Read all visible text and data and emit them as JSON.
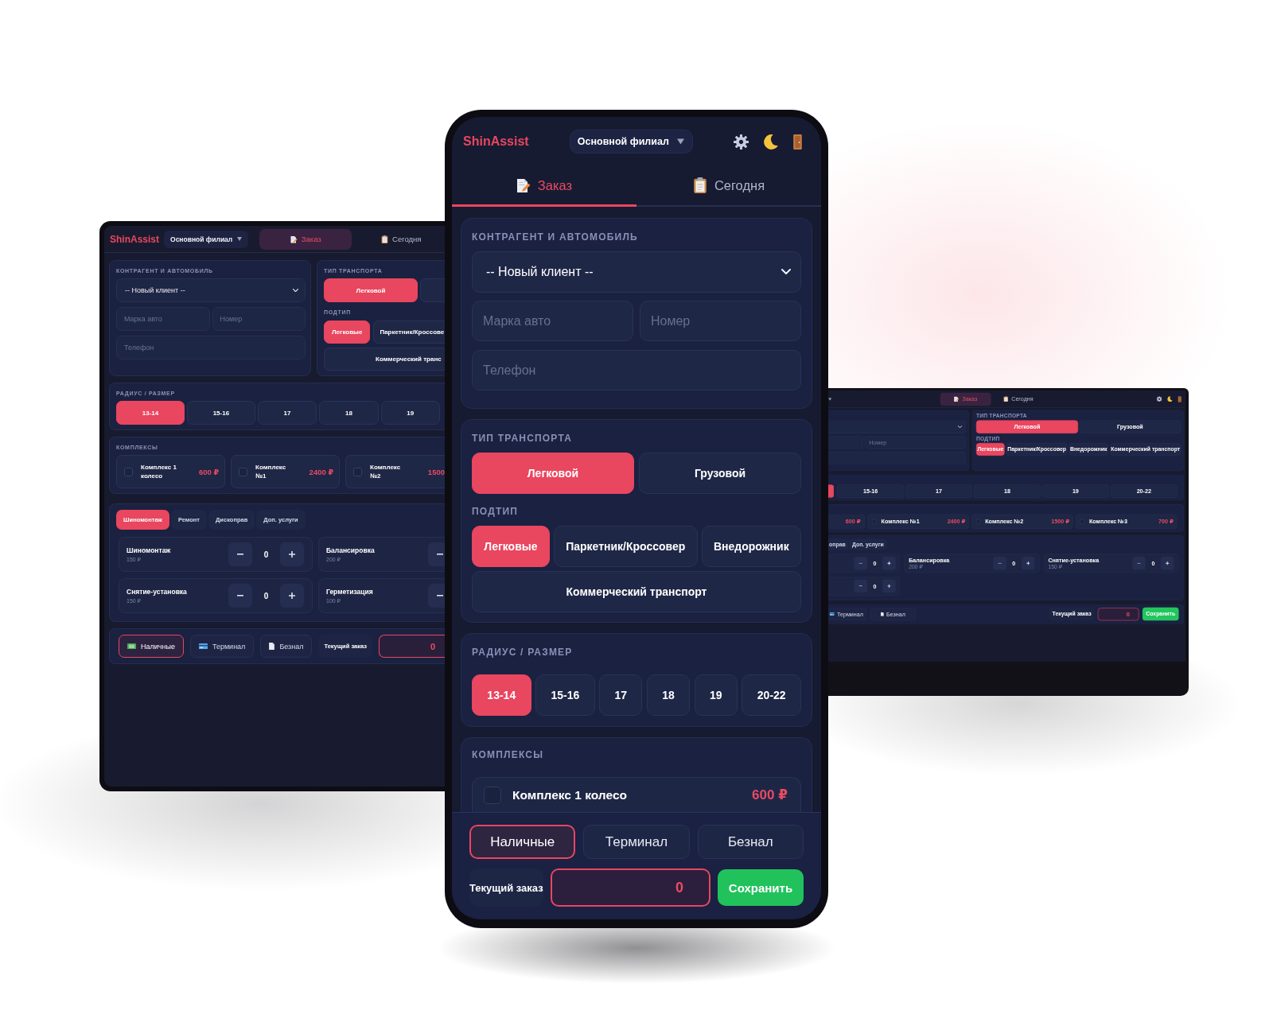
{
  "left_tablet": {
    "header": {
      "logo": "ShinAssist",
      "branch": "Основной филиал",
      "tabs": [
        {
          "kind": "order",
          "label": "Заказ",
          "selected": true
        },
        {
          "kind": "today",
          "label": "Сегодня",
          "selected": false
        }
      ]
    },
    "client_card": {
      "title": "КОНТРАГЕНТ И АВТОМОБИЛЬ",
      "client_select": {
        "value": "-- Новый клиент --"
      },
      "fields": [
        {
          "kind": "text",
          "placeholder": "Марка авто"
        },
        {
          "kind": "text",
          "placeholder": "Номер"
        },
        {
          "kind": "phone",
          "placeholder": "Телефон"
        }
      ]
    },
    "transport_card": {
      "title": "ТИП ТРАНСПОРТА",
      "types": [
        {
          "label": "Легковой",
          "selected": true
        },
        {
          "selected": false
        }
      ],
      "subtype_title": "ПОДТИП",
      "subtypes": [
        {
          "label": "Легковые",
          "selected": true
        },
        {
          "label": "Паркетник/Кроссове",
          "selected": false
        },
        {
          "label": "Коммерческий транс",
          "selected": false
        }
      ]
    },
    "size_card": {
      "title": "РАДИУС / РАЗМЕР",
      "sizes": [
        {
          "label": "13-14",
          "selected": true
        },
        {
          "label": "15-16",
          "selected": false
        },
        {
          "label": "17",
          "selected": false
        },
        {
          "label": "18",
          "selected": false
        },
        {
          "label": "19",
          "selected": false
        }
      ]
    },
    "complexes_card": {
      "title": "КОМПЛЕКСЫ",
      "items": [
        {
          "name": "Комплекс 1 колесо",
          "price": "600 ₽",
          "checked": false
        },
        {
          "name": "Комплекс №1",
          "price": "2400 ₽",
          "checked": false
        },
        {
          "name": "Комплекс №2",
          "price": "1500",
          "checked": false
        }
      ]
    },
    "services_card": {
      "tabs": [
        {
          "label": "Шиномонтаж",
          "selected": true
        },
        {
          "label": "Ремонт",
          "selected": false
        },
        {
          "label": "Дископрав",
          "selected": false
        },
        {
          "label": "Доп. услуги",
          "selected": false
        }
      ],
      "items": [
        {
          "name": "Шиномонтаж",
          "price": "150 ₽",
          "quantity": "0"
        },
        {
          "name": "Балансировка",
          "price": "200 ₽"
        },
        {
          "name": "Снятие-установка",
          "price": "150 ₽",
          "quantity": "0"
        },
        {
          "name": "Герметизация",
          "price": "100 ₽"
        }
      ]
    },
    "payment_card": {
      "methods": [
        {
          "kind": "cash",
          "label": "Наличные",
          "selected": true
        },
        {
          "kind": "terminal",
          "label": "Терминал",
          "selected": false
        },
        {
          "kind": "transfer",
          "label": "Безнал",
          "selected": false
        }
      ],
      "current_order": "Текущий заказ",
      "total": "0"
    }
  },
  "phone": {
    "header": {
      "logo": "ShinAssist",
      "branch": "Основной филиал",
      "tabs": [
        {
          "kind": "order",
          "label": "Заказ",
          "selected": true
        },
        {
          "kind": "today",
          "label": "Сегодня",
          "selected": false
        }
      ]
    },
    "client_card": {
      "title": "КОНТРАГЕНТ И АВТОМОБИЛЬ",
      "client_select": {
        "value": "-- Новый клиент --"
      },
      "fields": [
        {
          "kind": "text",
          "placeholder": "Марка авто"
        },
        {
          "kind": "text",
          "placeholder": "Номер"
        },
        {
          "kind": "phone",
          "placeholder": "Телефон"
        }
      ]
    },
    "transport_card": {
      "title": "ТИП ТРАНСПОРТА",
      "types": [
        {
          "label": "Легковой",
          "selected": true
        },
        {
          "label": "Грузовой",
          "selected": false
        }
      ],
      "subtype_title": "ПОДТИП",
      "subtypes": [
        {
          "label": "Легковые",
          "selected": true
        },
        {
          "label": "Паркетник/Кроссовер",
          "selected": false
        },
        {
          "label": "Внедорожник",
          "selected": false
        },
        {
          "label": "Коммерческий транспорт",
          "selected": false
        }
      ]
    },
    "size_card": {
      "title": "РАДИУС / РАЗМЕР",
      "sizes": [
        {
          "label": "13-14",
          "selected": true
        },
        {
          "label": "15-16",
          "selected": false
        },
        {
          "label": "17",
          "selected": false
        },
        {
          "label": "18",
          "selected": false
        },
        {
          "label": "19",
          "selected": false
        },
        {
          "label": "20-22",
          "selected": false
        }
      ]
    },
    "complexes_card": {
      "title": "КОМПЛЕКСЫ",
      "items": [
        {
          "name": "Комплекс 1 колесо",
          "price": "600 ₽",
          "checked": false
        }
      ]
    },
    "footer": {
      "methods": [
        {
          "label": "Наличные",
          "selected": true
        },
        {
          "label": "Терминал",
          "selected": false
        },
        {
          "label": "Безнал",
          "selected": false
        }
      ],
      "current_order": "Текущий заказ",
      "total": "0",
      "save": "Сохранить"
    }
  },
  "right_tablet": {
    "header": {
      "tabs": [
        {
          "kind": "order",
          "label": "Заказ",
          "selected": true
        },
        {
          "kind": "today",
          "label": "Сегодня",
          "selected": false
        }
      ]
    },
    "client_card": {
      "fields": [
        {
          "kind": "text"
        },
        {
          "kind": "text",
          "placeholder": "Номер"
        },
        {
          "kind": "phone"
        }
      ]
    },
    "transport_card": {
      "title": "ТИП ТРАНСПОРТА",
      "types": [
        {
          "label": "Легковой",
          "selected": true
        },
        {
          "label": "Грузовой",
          "selected": false
        }
      ],
      "subtype_title": "ПОДТИП",
      "subtypes": [
        {
          "label": "Легковые",
          "selected": true
        },
        {
          "label": "Паркетник/Кроссовер",
          "selected": false
        },
        {
          "label": "Внедорожник",
          "selected": false
        },
        {
          "label": "Коммерческий транспорт",
          "selected": false
        }
      ]
    },
    "size_card": {
      "sizes": [
        {
          "selected": true
        },
        {
          "label": "15-16",
          "selected": false
        },
        {
          "label": "17",
          "selected": false
        },
        {
          "label": "18",
          "selected": false
        },
        {
          "label": "19",
          "selected": false
        },
        {
          "label": "20-22",
          "selected": false
        }
      ]
    },
    "complexes_card": {
      "items": [
        {
          "price": "600 ₽"
        },
        {
          "name": "Комплекс №1",
          "price": "2400 ₽",
          "checked": false
        },
        {
          "name": "Комплекс №2",
          "price": "1500 ₽",
          "checked": false
        },
        {
          "name": "Комплекс №3",
          "price": "700 ₽",
          "checked": false
        }
      ]
    },
    "services_card": {
      "tabs": [
        {
          "label": "оправ",
          "selected": false
        },
        {
          "label": "Доп. услуги",
          "selected": false
        }
      ],
      "items": [
        {
          "quantity": "0"
        },
        {
          "name": "Балансировка",
          "price": "200 ₽",
          "quantity": "0"
        },
        {
          "name": "Снятие-установка",
          "price": "150 ₽",
          "quantity": "0"
        },
        {
          "quantity": "0"
        }
      ]
    },
    "payment_card": {
      "methods": [
        {
          "kind": "terminal",
          "label": "Терминал",
          "selected": false
        },
        {
          "kind": "transfer",
          "label": "Безнал",
          "selected": false
        }
      ],
      "current_order": "Текущий заказ",
      "total": "0",
      "save": "Сохранить"
    }
  }
}
